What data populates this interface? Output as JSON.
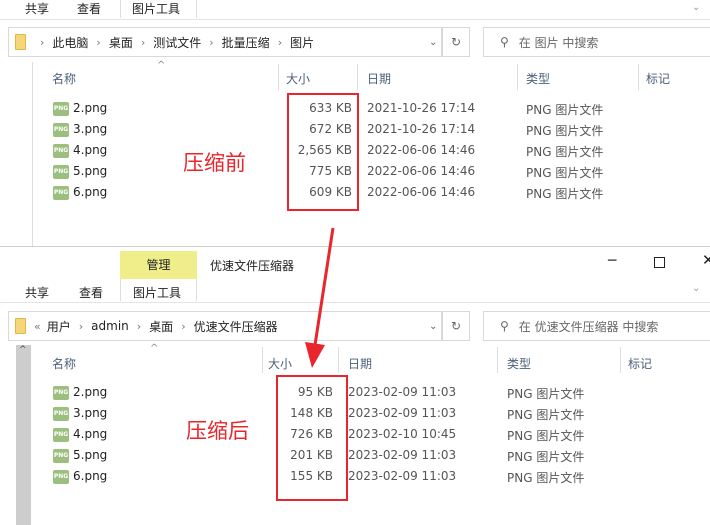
{
  "top_window": {
    "ribbon_tabs": [
      "共享",
      "查看",
      "图片工具"
    ],
    "breadcrumb": [
      "此电脑",
      "桌面",
      "测试文件",
      "批量压缩",
      "图片"
    ],
    "search_placeholder": "在 图片 中搜索",
    "columns": {
      "name": "名称",
      "size": "大小",
      "date": "日期",
      "type": "类型",
      "tags": "标记"
    },
    "files": [
      {
        "name": "2.png",
        "size": "633 KB",
        "date": "2021-10-26 17:14",
        "type": "PNG 图片文件"
      },
      {
        "name": "3.png",
        "size": "672 KB",
        "date": "2021-10-26 17:14",
        "type": "PNG 图片文件"
      },
      {
        "name": "4.png",
        "size": "2,565 KB",
        "date": "2022-06-06 14:46",
        "type": "PNG 图片文件"
      },
      {
        "name": "5.png",
        "size": "775 KB",
        "date": "2022-06-06 14:46",
        "type": "PNG 图片文件"
      },
      {
        "name": "6.png",
        "size": "609 KB",
        "date": "2022-06-06 14:46",
        "type": "PNG 图片文件"
      }
    ]
  },
  "bottom_window": {
    "manage_tab": "管理",
    "title": "优速文件压缩器",
    "ribbon_tabs": [
      "共享",
      "查看",
      "图片工具"
    ],
    "breadcrumb_prefix": "«",
    "breadcrumb": [
      "用户",
      "admin",
      "桌面",
      "优速文件压缩器"
    ],
    "search_placeholder": "在 优速文件压缩器 中搜索",
    "columns": {
      "name": "名称",
      "size": "大小",
      "date": "日期",
      "type": "类型",
      "tags": "标记"
    },
    "files": [
      {
        "name": "2.png",
        "size": "95 KB",
        "date": "2023-02-09 11:03",
        "type": "PNG 图片文件"
      },
      {
        "name": "3.png",
        "size": "148 KB",
        "date": "2023-02-09 11:03",
        "type": "PNG 图片文件"
      },
      {
        "name": "4.png",
        "size": "726 KB",
        "date": "2023-02-10 10:45",
        "type": "PNG 图片文件"
      },
      {
        "name": "5.png",
        "size": "201 KB",
        "date": "2023-02-09 11:03",
        "type": "PNG 图片文件"
      },
      {
        "name": "6.png",
        "size": "155 KB",
        "date": "2023-02-09 11:03",
        "type": "PNG 图片文件"
      }
    ]
  },
  "annotations": {
    "before": "压缩前",
    "after": "压缩后",
    "color": "#e8262c"
  },
  "icon_text": "PNG"
}
